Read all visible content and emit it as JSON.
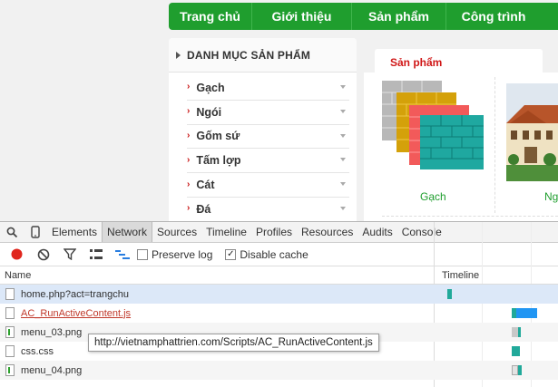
{
  "site": {
    "nav": [
      "Trang chủ",
      "Giới thiệu",
      "Sản phẩm",
      "Công trình"
    ],
    "category": {
      "title": "DANH MỤC SẢN PHẨM",
      "items": [
        "Gạch",
        "Ngói",
        "Gốm sứ",
        "Tấm lợp",
        "Cát",
        "Đá"
      ]
    },
    "products": {
      "tab": "Sản phẩm",
      "items": [
        "Gạch",
        "Ng"
      ]
    }
  },
  "devtools": {
    "tabs": [
      "Elements",
      "Network",
      "Sources",
      "Timeline",
      "Profiles",
      "Resources",
      "Audits",
      "Console"
    ],
    "active_tab": "Network",
    "toolbar": {
      "preserve_log": "Preserve log",
      "preserve_log_checked": false,
      "disable_cache": "Disable cache",
      "disable_cache_checked": true
    },
    "columns": {
      "name": "Name",
      "timeline": "Timeline"
    },
    "requests": [
      {
        "name": "home.php?act=trangchu",
        "type": "doc",
        "error": false
      },
      {
        "name": "AC_RunActiveContent.js",
        "type": "doc",
        "error": true
      },
      {
        "name": "menu_03.png",
        "type": "img",
        "error": false
      },
      {
        "name": "css.css",
        "type": "doc",
        "error": false
      },
      {
        "name": "menu_04.png",
        "type": "img",
        "error": false
      }
    ],
    "tooltip": "http://vietnamphattrien.com/Scripts/AC_RunActiveContent.js"
  },
  "colors": {
    "nav_green": "#1f9e2e",
    "accent_red": "#d01818",
    "record_red": "#e0261d",
    "timeline_teal": "#21a99a",
    "timeline_blue": "#2196f3"
  }
}
